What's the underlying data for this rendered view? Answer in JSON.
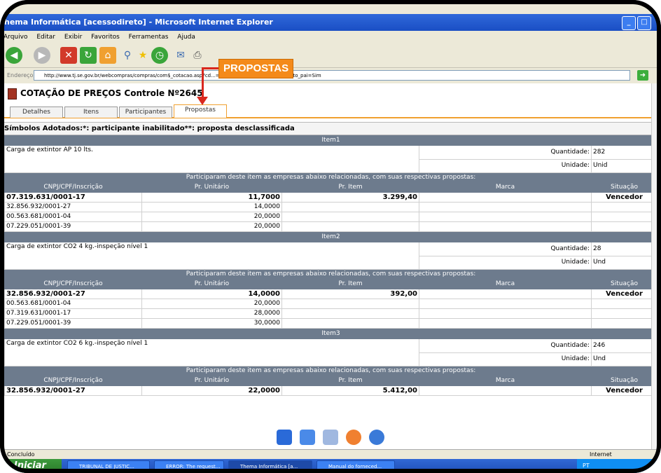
{
  "window": {
    "title": "hema Informática [acessodireto] - Microsoft Internet Explorer"
  },
  "menu": [
    "Arquivo",
    "Editar",
    "Exibir",
    "Favoritos",
    "Ferramentas",
    "Ajuda"
  ],
  "address": {
    "label": "Endereço",
    "url": "http://www.tj.se.gov.br/webcompras/compras/com$_cotacao.asp?cd...=2645&indice_atual=1&contexto_pai=Sim"
  },
  "callout": "PROPOSTAS",
  "page": {
    "title": "COTAÇÃO DE PREÇOS Controle Nº2645",
    "tabs": [
      "Detalhes",
      "Itens",
      "Participantes",
      "Propostas"
    ],
    "active_tab": "Propostas",
    "legend": "Símbolos Adotados:*: participante inabilitado**: proposta desclassificada"
  },
  "labels": {
    "quantidade": "Quantidade:",
    "unidade": "Unidade:",
    "participaram": "Participaram deste item as empresas abaixo relacionadas, com suas respectivas propostas:"
  },
  "columns": [
    "CNPJ/CPF/Inscrição",
    "Pr. Unitário",
    "Pr. Item",
    "Marca",
    "Situação"
  ],
  "items": [
    {
      "header": "Item1",
      "description": "Carga de extintor AP 10 lts.",
      "quantidade": "282",
      "unidade": "Unid",
      "rows": [
        {
          "cnpj": "07.319.631/0001-17",
          "unit": "11,7000",
          "item": "3.299,40",
          "marca": "",
          "situacao": "Vencedor",
          "win": true
        },
        {
          "cnpj": "32.856.932/0001-27",
          "unit": "14,0000",
          "item": "",
          "marca": "",
          "situacao": "",
          "win": false
        },
        {
          "cnpj": "00.563.681/0001-04",
          "unit": "20,0000",
          "item": "",
          "marca": "",
          "situacao": "",
          "win": false
        },
        {
          "cnpj": "07.229.051/0001-39",
          "unit": "20,0000",
          "item": "",
          "marca": "",
          "situacao": "",
          "win": false
        }
      ]
    },
    {
      "header": "Item2",
      "description": "Carga de extintor CO2 4 kg.-inspeção nível 1",
      "quantidade": "28",
      "unidade": "Und",
      "rows": [
        {
          "cnpj": "32.856.932/0001-27",
          "unit": "14,0000",
          "item": "392,00",
          "marca": "",
          "situacao": "Vencedor",
          "win": true
        },
        {
          "cnpj": "00.563.681/0001-04",
          "unit": "20,0000",
          "item": "",
          "marca": "",
          "situacao": "",
          "win": false
        },
        {
          "cnpj": "07.319.631/0001-17",
          "unit": "28,0000",
          "item": "",
          "marca": "",
          "situacao": "",
          "win": false
        },
        {
          "cnpj": "07.229.051/0001-39",
          "unit": "30,0000",
          "item": "",
          "marca": "",
          "situacao": "",
          "win": false
        }
      ]
    },
    {
      "header": "Item3",
      "description": "Carga de extintor CO2 6 kg.-inspeção nível 1",
      "quantidade": "246",
      "unidade": "Und",
      "rows": [
        {
          "cnpj": "32.856.932/0001-27",
          "unit": "22,0000",
          "item": "5.412,00",
          "marca": "",
          "situacao": "Vencedor",
          "win": true
        }
      ]
    }
  ],
  "status": {
    "left": "Concluído",
    "zone": "Internet"
  },
  "taskbar": {
    "start": "Iniciar",
    "tasks": [
      "TRIBUNAL DE JUSTIC...",
      "ERROR: The request...",
      "Thema Informática [a...",
      "Manual do forneced..."
    ],
    "tray": "PT"
  }
}
